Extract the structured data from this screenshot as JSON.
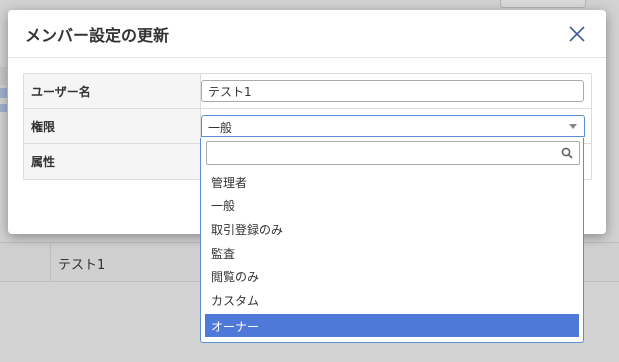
{
  "modal": {
    "title": "メンバー設定の更新"
  },
  "form": {
    "username_label": "ユーザー名",
    "username_value": "テスト1",
    "role_label": "権限",
    "role_value": "一般",
    "attribute_label": "属性"
  },
  "dropdown": {
    "search_value": "",
    "options": [
      "管理者",
      "一般",
      "取引登録のみ",
      "監査",
      "閲覧のみ",
      "カスタム",
      "オーナー"
    ],
    "highlighted_option": "オーナー"
  },
  "background": {
    "row_text": "テスト1"
  },
  "colors": {
    "accent": "#4f79d8",
    "focus_border": "#5b8fd9",
    "close_icon": "#3c5c9a"
  }
}
